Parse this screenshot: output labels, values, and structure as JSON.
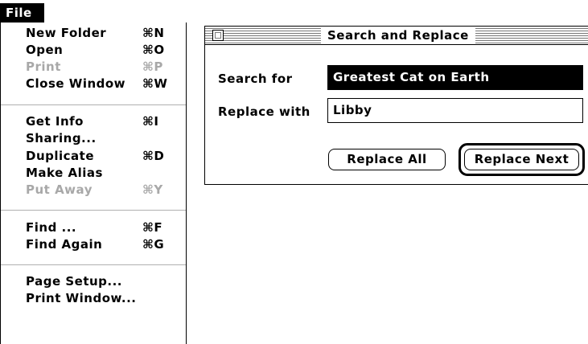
{
  "menu": {
    "title": "File",
    "items": [
      {
        "label": "New Folder",
        "shortcut": "⌘N",
        "enabled": true
      },
      {
        "label": "Open",
        "shortcut": "⌘O",
        "enabled": true
      },
      {
        "label": "Print",
        "shortcut": "⌘P",
        "enabled": false
      },
      {
        "label": "Close Window",
        "shortcut": "⌘W",
        "enabled": true
      },
      {
        "label": "Get Info",
        "shortcut": "⌘I",
        "enabled": true
      },
      {
        "label": "Sharing...",
        "shortcut": "",
        "enabled": true
      },
      {
        "label": "Duplicate",
        "shortcut": "⌘D",
        "enabled": true
      },
      {
        "label": "Make Alias",
        "shortcut": "",
        "enabled": true
      },
      {
        "label": "Put Away",
        "shortcut": "⌘Y",
        "enabled": false
      },
      {
        "label": "Find ...",
        "shortcut": "⌘F",
        "enabled": true
      },
      {
        "label": "Find Again",
        "shortcut": "⌘G",
        "enabled": true
      },
      {
        "label": "Page Setup...",
        "shortcut": "",
        "enabled": true
      },
      {
        "label": "Print Window...",
        "shortcut": "",
        "enabled": true
      }
    ]
  },
  "dialog": {
    "title": "Search and Replace",
    "search_label": "Search for",
    "search_value": "Greatest Cat on Earth",
    "replace_label": "Replace with",
    "replace_value": "Libby",
    "replace_all_label": "Replace All",
    "replace_next_label": "Replace Next"
  }
}
